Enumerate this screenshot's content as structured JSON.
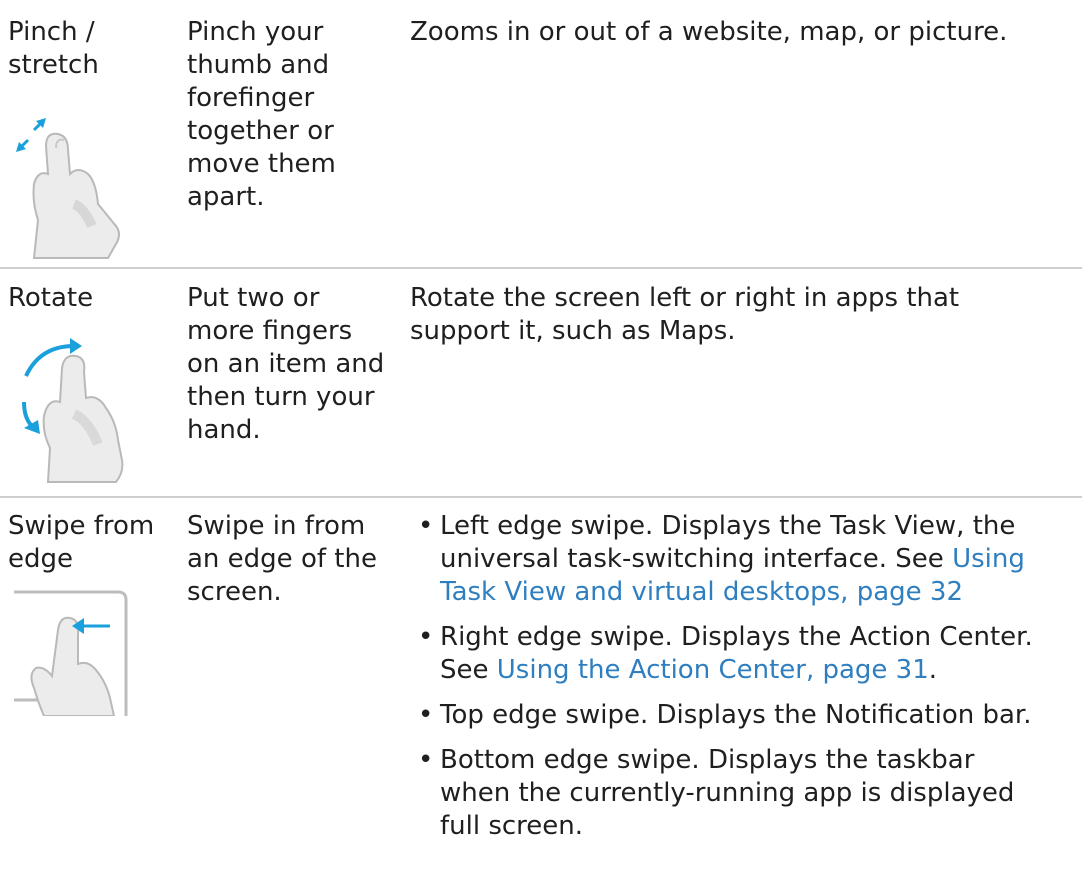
{
  "gestures": [
    {
      "name_lines": [
        "Pinch /",
        "stretch"
      ],
      "action_lines": [
        "Pinch your",
        "thumb and",
        "forefinger",
        "together or",
        "move them",
        "apart."
      ],
      "result": "Zooms in or out of a website, map, or picture.",
      "icon": "pinch-stretch-hand-icon"
    },
    {
      "name_lines": [
        "Rotate"
      ],
      "action_lines": [
        "Put two or",
        "more fingers",
        "on an item and",
        "then turn your",
        "hand."
      ],
      "result_lines": [
        "Rotate the screen left or right in apps that",
        "support it, such as Maps."
      ],
      "icon": "rotate-hand-icon"
    },
    {
      "name_lines": [
        "Swipe from",
        "edge"
      ],
      "action_lines": [
        "Swipe in from",
        "an edge of the",
        "screen."
      ],
      "icon": "swipe-edge-hand-icon",
      "bullets": [
        {
          "line1": "Left edge swipe. Displays the Task View, the",
          "line2_text": "universal task-switching interface. See ",
          "line2_link": "Using",
          "line3_link": "Task View and virtual desktops, page 32"
        },
        {
          "line1": "Right edge swipe. Displays the Action Center.",
          "line2_text": "See ",
          "line2_link": "Using the Action Center, page 31",
          "line2_after": "."
        },
        {
          "line1": "Top edge swipe. Displays the Notification bar."
        },
        {
          "line1": "Bottom edge swipe. Displays the taskbar",
          "line2_text": "when the currently-running app is displayed",
          "line3_text": "full screen."
        }
      ]
    }
  ],
  "colors": {
    "text": "#1f1f1f",
    "link": "#2f7fc0",
    "divider": "#cfcfcf",
    "gesture_arrow": "#1aa0dc"
  }
}
